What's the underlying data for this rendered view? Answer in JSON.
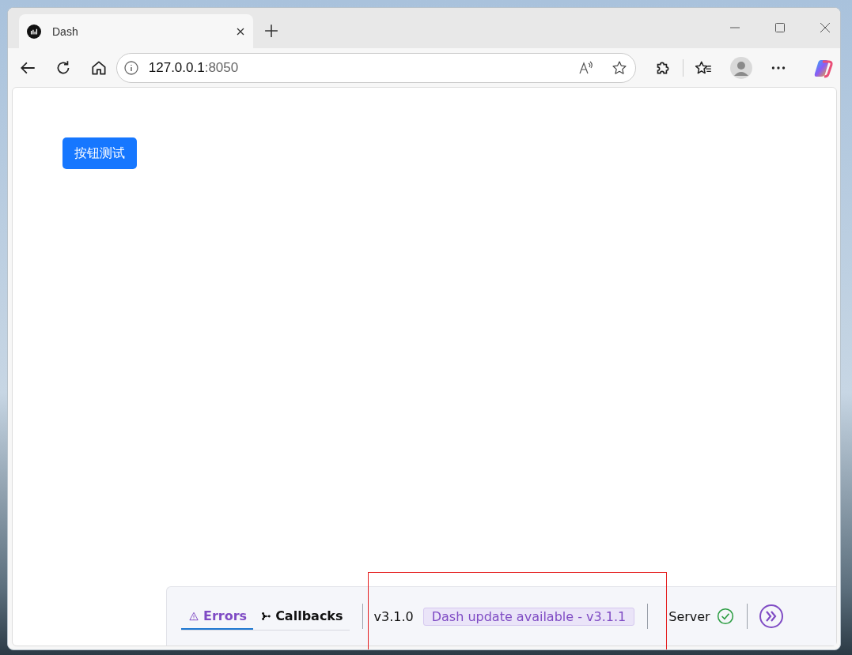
{
  "browser": {
    "tab_title": "Dash",
    "address": {
      "host": "127.0.0.1",
      "port": ":8050"
    }
  },
  "page": {
    "button": "按钮测试"
  },
  "devtools": {
    "tabs": [
      {
        "label": "Errors",
        "kind": "errors",
        "selected": true
      },
      {
        "label": "Callbacks",
        "kind": "callbacks",
        "selected": false
      }
    ],
    "version": "v3.1.0",
    "update_badge": "Dash update available - v3.1.1",
    "server": {
      "label": "Server",
      "ok": true
    }
  },
  "highlight": {
    "shown": true
  }
}
